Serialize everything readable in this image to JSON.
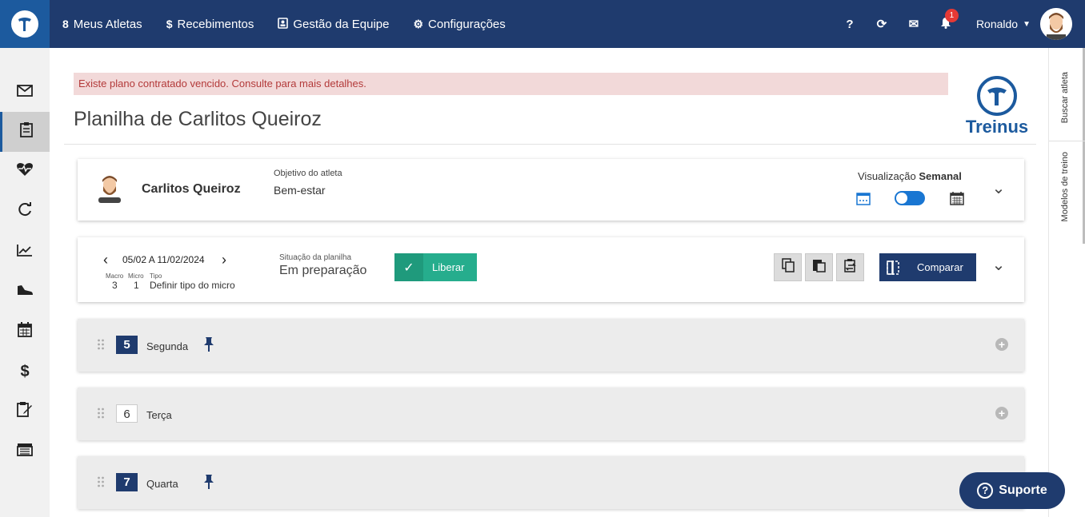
{
  "topbar": {
    "nav": [
      {
        "label": "Meus Atletas",
        "icon": "athlete-icon"
      },
      {
        "label": "Recebimentos",
        "icon": "dollar-icon"
      },
      {
        "label": "Gestão da Equipe",
        "icon": "team-icon"
      },
      {
        "label": "Configurações",
        "icon": "gears-icon"
      }
    ],
    "help": "?",
    "notifications_count": "1",
    "user_name": "Ronaldo"
  },
  "alert": "Existe plano contratado vencido. Consulte para mais detalhes.",
  "page_title": "Planilha de Carlitos Queiroz",
  "brand_name": "Treinus",
  "athlete": {
    "name": "Carlitos Queiroz",
    "objective_label": "Objetivo do atleta",
    "objective_value": "Bem-estar",
    "view_label": "Visualização",
    "view_mode": "Semanal"
  },
  "week": {
    "range": "05/02 A 11/02/2024",
    "macro_label": "Macro",
    "micro_label": "Micro",
    "tipo_label": "Tipo",
    "macro": "3",
    "micro": "1",
    "tipo": "Definir tipo do micro",
    "status_label": "Situação da planilha",
    "status_value": "Em preparação",
    "liberar_label": "Liberar",
    "comparar_label": "Comparar"
  },
  "days": [
    {
      "num": "5",
      "name": "Segunda",
      "pinned": true
    },
    {
      "num": "6",
      "name": "Terça",
      "pinned": false
    },
    {
      "num": "7",
      "name": "Quarta",
      "pinned": true
    }
  ],
  "right_tabs": {
    "search": "Buscar atleta",
    "models": "Modelos de treino"
  },
  "support_label": "Suporte",
  "colors": {
    "primary": "#1f3b6e",
    "accent": "#1c5a9e",
    "success": "#26ad8d",
    "alert_bg": "#f2d9d9",
    "alert_text": "#b33a3a"
  }
}
